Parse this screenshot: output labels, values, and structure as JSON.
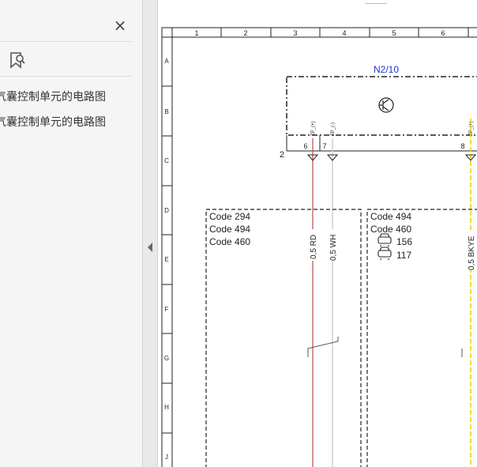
{
  "sidebar": {
    "close_glyph": "×",
    "bookmark_icon": "bookmark-search-icon",
    "items": [
      {
        "label": "气囊控制单元的电路图"
      },
      {
        "label": "气囊控制单元的电路图"
      }
    ]
  },
  "drawing": {
    "columns": [
      "1",
      "2",
      "3",
      "4",
      "5",
      "6"
    ],
    "rows": [
      "A",
      "B",
      "C",
      "D",
      "E",
      "F",
      "G",
      "H",
      "J"
    ],
    "component": "N2/10",
    "pin_labels": [
      "6",
      "7",
      "8"
    ],
    "connector_label": "2",
    "pin_signals": [
      "ZP_(+)",
      "ZP_(-)",
      "ZP_(+)"
    ],
    "left_box_codes": [
      "Code 294",
      "Code 494",
      "Code 460"
    ],
    "right_box_codes": [
      "Code 494",
      "Code 460"
    ],
    "right_box_variants": [
      "156",
      "117"
    ],
    "wires": [
      "0,5 RD",
      "0,5 WH",
      "0,5 BKYE"
    ],
    "colors": {
      "red_wire": "#b84a4a",
      "white_wire": "#cfcfcf",
      "yellow_wire": "#e7d400",
      "component_label": "#2233cc"
    }
  }
}
